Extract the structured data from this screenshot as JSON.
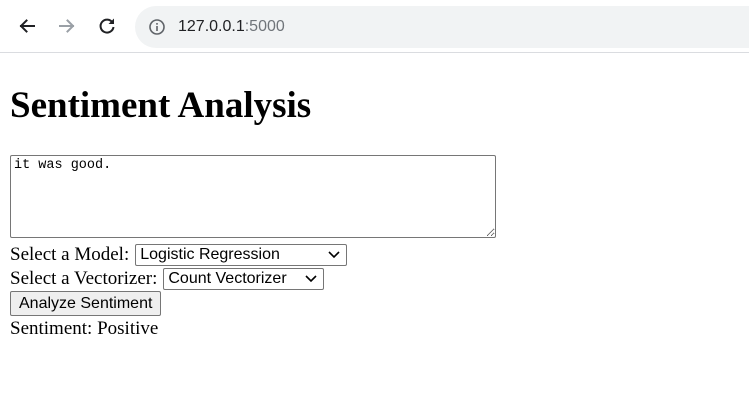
{
  "browser": {
    "url_host": "127.0.0.1",
    "url_port": ":5000",
    "icons": [
      "back-arrow-icon",
      "forward-arrow-icon",
      "reload-icon",
      "info-icon"
    ]
  },
  "page": {
    "title": "Sentiment Analysis",
    "text_input": {
      "value": "it was good."
    },
    "model": {
      "label": "Select a Model:",
      "selected": "Logistic Regression"
    },
    "vectorizer": {
      "label": "Select a Vectorizer:",
      "selected": "Count Vectorizer"
    },
    "analyze_button": "Analyze Sentiment",
    "result": {
      "label": "Sentiment:",
      "value": "Positive"
    }
  },
  "colors": {
    "omnibox_bg": "#f1f3f4",
    "forward_disabled": "#9aa0a6",
    "icon_active": "#5f6368"
  }
}
